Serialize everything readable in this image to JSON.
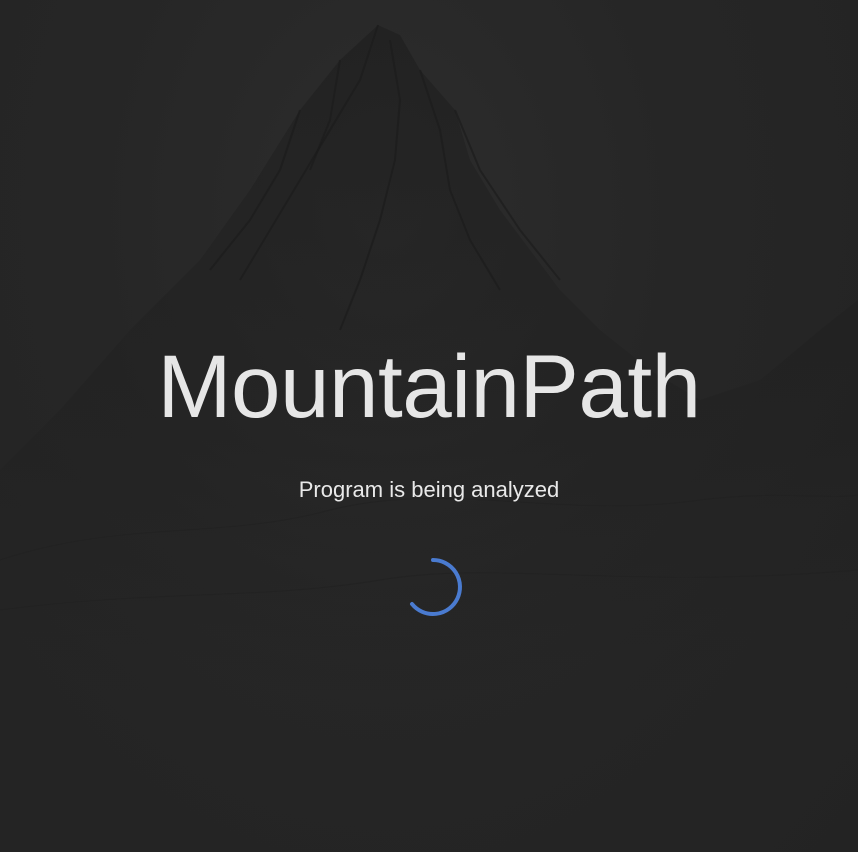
{
  "app": {
    "title": "MountainPath",
    "status": "Program is being analyzed"
  },
  "loading_indicator": {
    "icon": "spinner-icon",
    "color": "#4a7bd0"
  },
  "background": {
    "image": "mountain-silhouette",
    "color": "#242424"
  }
}
